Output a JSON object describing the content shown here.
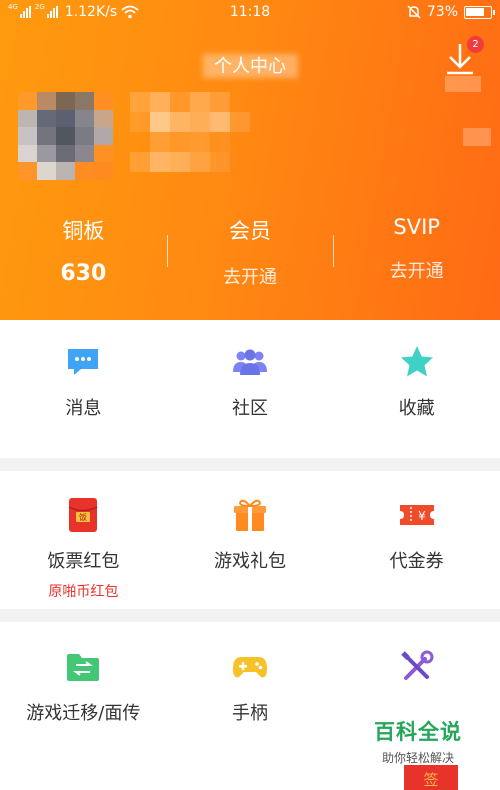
{
  "status_bar": {
    "network_tag_1": "4G",
    "network_tag_2": "2G",
    "speed": "1.12K/s",
    "time": "11:18",
    "battery_text": "73%",
    "battery_level": 0.73
  },
  "header": {
    "title": "个人中心",
    "download_badge": "2"
  },
  "stats": [
    {
      "label": "铜板",
      "value": "630"
    },
    {
      "label": "会员",
      "value": "去开通"
    },
    {
      "label": "SVIP",
      "value": "去开通"
    }
  ],
  "section1": [
    {
      "label": "消息",
      "icon": "message-icon",
      "color": "#3fa4f6"
    },
    {
      "label": "社区",
      "icon": "community-icon",
      "color": "#7b84f2"
    },
    {
      "label": "收藏",
      "icon": "star-icon",
      "color": "#3fd1c3"
    }
  ],
  "section2": [
    {
      "label": "饭票红包",
      "sub": "原啪币红包",
      "icon": "red-envelope-icon",
      "color": "#e8332a"
    },
    {
      "label": "游戏礼包",
      "icon": "gift-icon",
      "color": "#ff8a1f"
    },
    {
      "label": "代金券",
      "icon": "voucher-icon",
      "color": "#f04c2c"
    }
  ],
  "section3": [
    {
      "label": "游戏迁移/面传",
      "icon": "transfer-icon",
      "color": "#43c675"
    },
    {
      "label": "手柄",
      "icon": "gamepad-icon",
      "color": "#f7c12a"
    },
    {
      "label": "",
      "icon": "tools-icon",
      "color": "#8e5ad6"
    }
  ],
  "watermark": {
    "title": "百科全说",
    "subtitle": "助你轻松解决",
    "tag": "签"
  }
}
